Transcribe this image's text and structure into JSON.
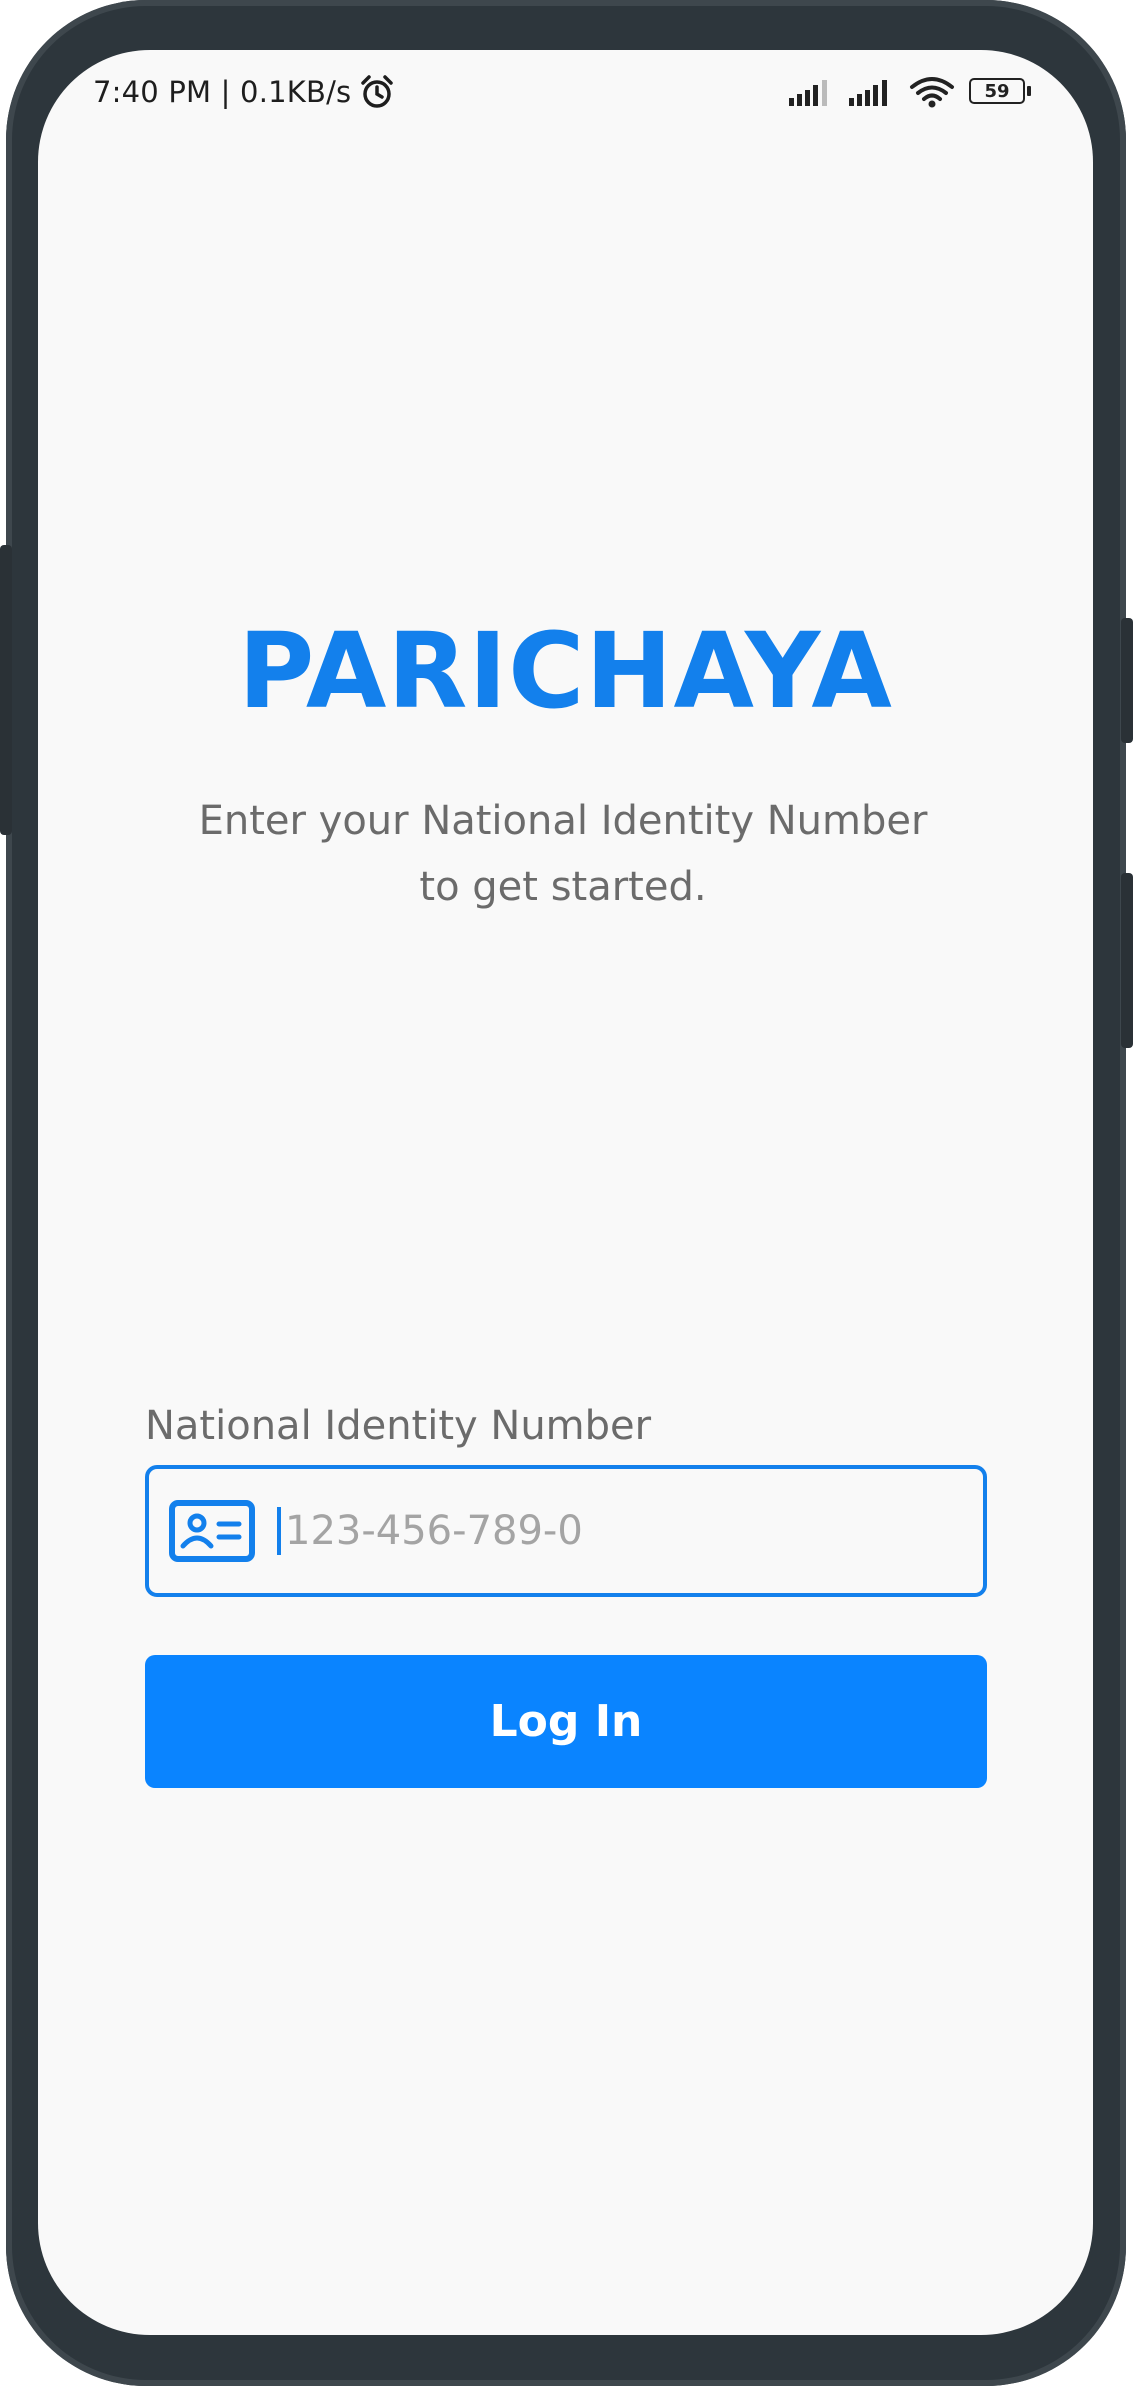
{
  "status_bar": {
    "time_and_speed": "7:40 PM | 0.1KB/s",
    "battery_level": "59",
    "icons": [
      "alarm-icon",
      "signal-icon",
      "signal-icon",
      "wifi-icon",
      "battery-icon"
    ]
  },
  "app": {
    "title": "PARICHAYA",
    "subtitle_line1": "Enter your National Identity Number",
    "subtitle_line2": "to get started."
  },
  "form": {
    "nin_label": "National Identity Number",
    "nin_placeholder": "123-456-789-0",
    "nin_value": "",
    "login_label": "Log In"
  },
  "colors": {
    "accent": "#1380ec",
    "button": "#0a84ff",
    "background": "#f9f9f9",
    "frame": "#2d363c"
  }
}
